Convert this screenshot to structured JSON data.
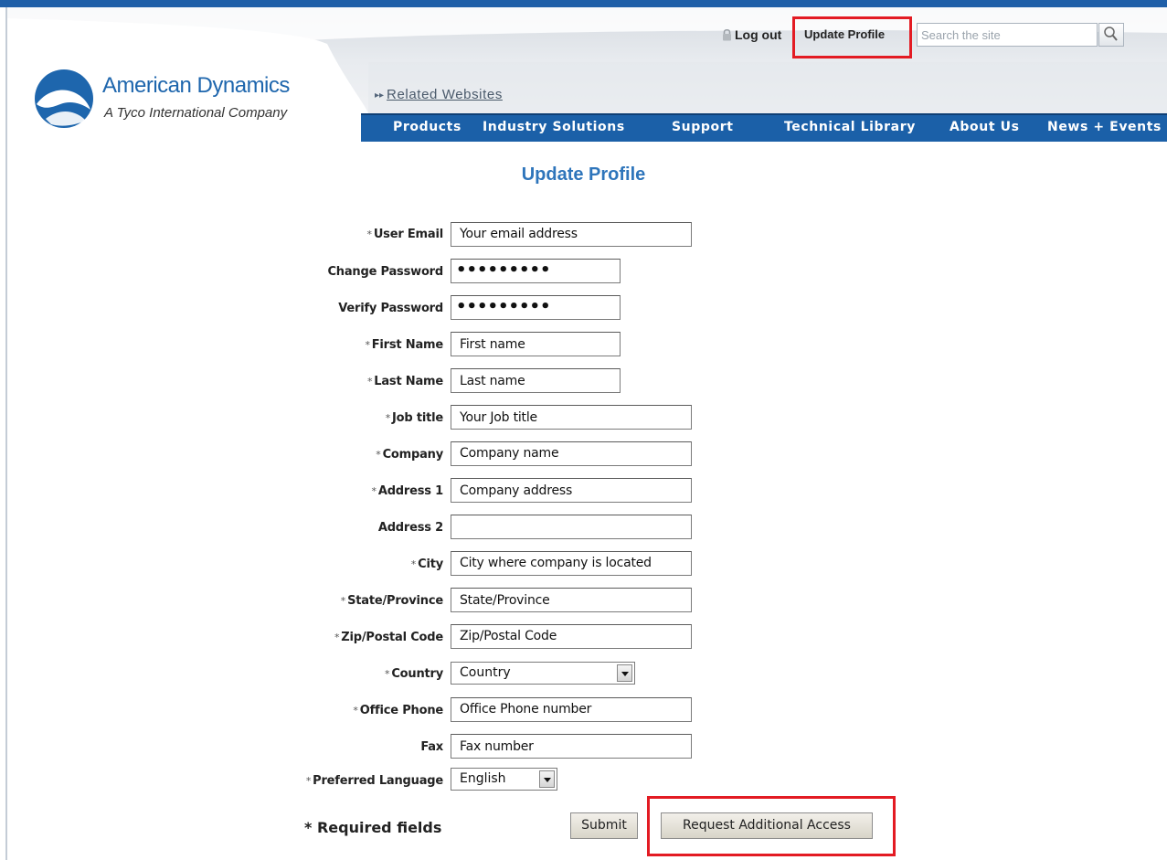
{
  "header": {
    "brand_name": "American Dynamics",
    "brand_tagline": "A Tyco International Company",
    "related_link": "Related Websites",
    "logout_label": "Log out",
    "update_profile_link": "Update Profile",
    "search_placeholder": "Search the site"
  },
  "nav": {
    "items": [
      "Products",
      "Industry Solutions",
      "Support",
      "Technical Library",
      "About Us",
      "News + Events"
    ]
  },
  "form": {
    "title": "Update Profile",
    "required_marker": "*",
    "fields": [
      {
        "label": "User Email",
        "required": true,
        "value": "Your email address"
      },
      {
        "label": "Change Password",
        "required": false,
        "value": "•••••••••"
      },
      {
        "label": "Verify Password",
        "required": false,
        "value": "•••••••••"
      },
      {
        "label": "First Name",
        "required": true,
        "value": "First name"
      },
      {
        "label": "Last Name",
        "required": true,
        "value": "Last name"
      },
      {
        "label": "Job title",
        "required": true,
        "value": "Your Job title"
      },
      {
        "label": "Company",
        "required": true,
        "value": "Company name"
      },
      {
        "label": "Address 1",
        "required": true,
        "value": "Company address"
      },
      {
        "label": "Address 2",
        "required": false,
        "value": ""
      },
      {
        "label": "City",
        "required": true,
        "value": "City where company is located"
      },
      {
        "label": "State/Province",
        "required": true,
        "value": "State/Province"
      },
      {
        "label": "Zip/Postal Code",
        "required": true,
        "value": "Zip/Postal Code"
      },
      {
        "label": "Country",
        "required": true,
        "value": "Country"
      },
      {
        "label": "Office Phone",
        "required": true,
        "value": "Office Phone number"
      },
      {
        "label": "Fax",
        "required": false,
        "value": "Fax number"
      },
      {
        "label": "Preferred Language",
        "required": true,
        "value": "English"
      }
    ],
    "required_note": "* Required fields",
    "submit_label": "Submit",
    "request_access_label": "Request Additional Access"
  },
  "colors": {
    "nav_bar": "#1b60a8",
    "title": "#2e75bb",
    "brand": "#1e66ad",
    "highlight": "#e31b23"
  }
}
